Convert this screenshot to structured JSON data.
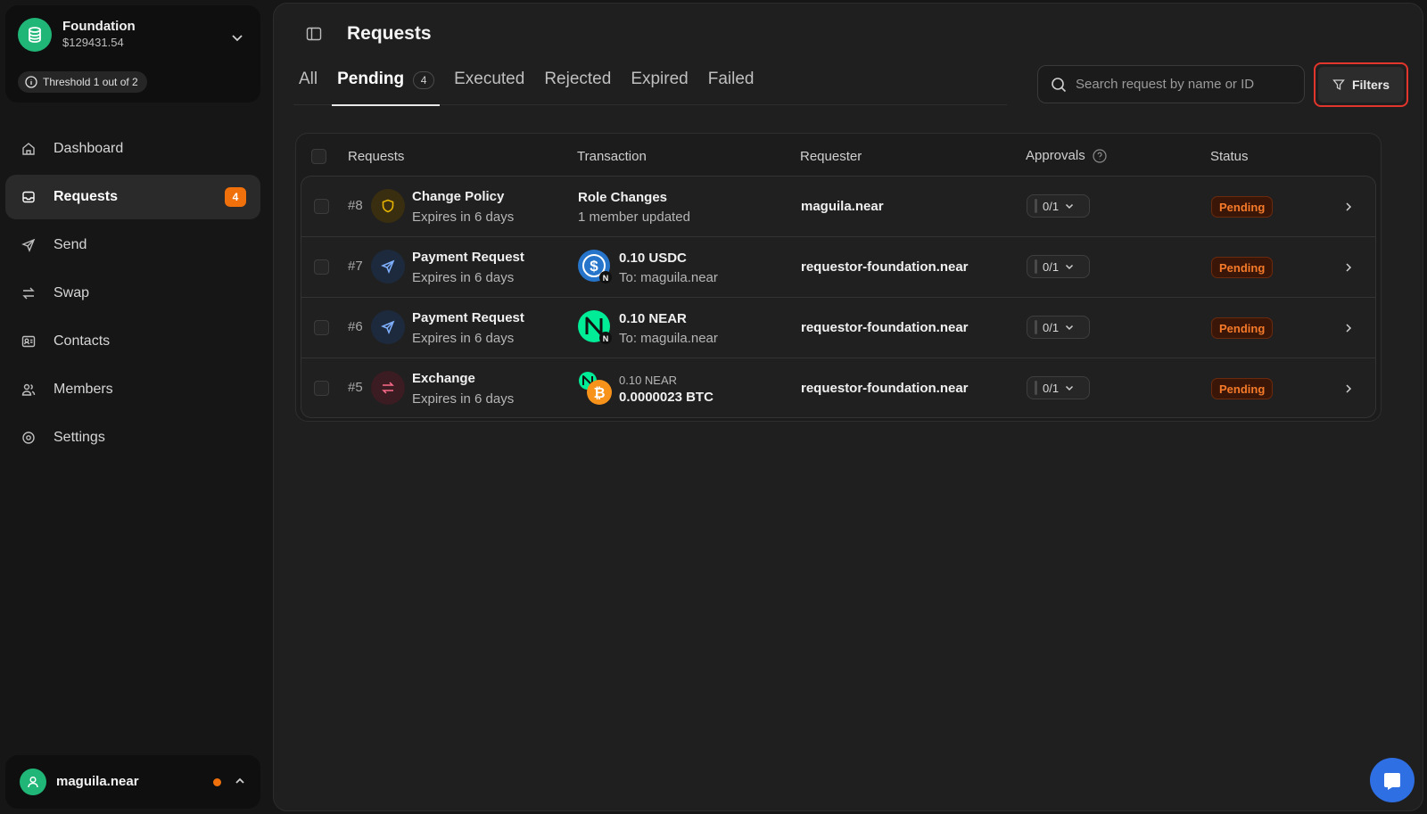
{
  "org": {
    "name": "Foundation",
    "balance": "$129431.54",
    "threshold": "Threshold 1 out of 2"
  },
  "sidebar": {
    "items": [
      {
        "label": "Dashboard",
        "icon": "home-icon"
      },
      {
        "label": "Requests",
        "icon": "inbox-icon",
        "badge": "4",
        "active": true
      },
      {
        "label": "Send",
        "icon": "send-icon"
      },
      {
        "label": "Swap",
        "icon": "swap-icon"
      },
      {
        "label": "Contacts",
        "icon": "contacts-icon"
      },
      {
        "label": "Members",
        "icon": "members-icon"
      },
      {
        "label": "Settings",
        "icon": "gear-icon"
      }
    ]
  },
  "user": {
    "name": "maguila.near"
  },
  "page": {
    "title": "Requests"
  },
  "tabs": [
    {
      "label": "All"
    },
    {
      "label": "Pending",
      "count": "4",
      "active": true
    },
    {
      "label": "Executed"
    },
    {
      "label": "Rejected"
    },
    {
      "label": "Expired"
    },
    {
      "label": "Failed"
    }
  ],
  "search": {
    "placeholder": "Search request by name or ID",
    "value": ""
  },
  "filters": {
    "label": "Filters"
  },
  "table": {
    "headers": {
      "requests": "Requests",
      "transaction": "Transaction",
      "requester": "Requester",
      "approvals": "Approvals",
      "status": "Status"
    },
    "rows": [
      {
        "id": "#8",
        "title": "Change Policy",
        "expires": "Expires in 6 days",
        "icon": "shield-icon",
        "tx_title": "Role Changes",
        "tx_sub": "1 member updated",
        "requester": "maguila.near",
        "approvals": "0/1",
        "status": "Pending"
      },
      {
        "id": "#7",
        "title": "Payment Request",
        "expires": "Expires in 6 days",
        "icon": "send-icon",
        "tx_amount": "0.10 USDC",
        "tx_to": "To: maguila.near",
        "token": "usdc-icon",
        "requester": "requestor-foundation.near",
        "approvals": "0/1",
        "status": "Pending"
      },
      {
        "id": "#6",
        "title": "Payment Request",
        "expires": "Expires in 6 days",
        "icon": "send-icon",
        "tx_amount": "0.10 NEAR",
        "tx_to": "To: maguila.near",
        "token": "near-icon",
        "requester": "requestor-foundation.near",
        "approvals": "0/1",
        "status": "Pending"
      },
      {
        "id": "#5",
        "title": "Exchange",
        "expires": "Expires in 6 days",
        "icon": "swap-icon",
        "tx_from": "0.10 NEAR",
        "tx_to_amount": "0.0000023 BTC",
        "token": "near-btc-icon",
        "requester": "requestor-foundation.near",
        "approvals": "0/1",
        "status": "Pending"
      }
    ]
  },
  "colors": {
    "accent_green": "#1fb677",
    "badge_orange": "#f0700c",
    "status_pending": "#f57a2a",
    "filters_highlight": "#e2352b",
    "chat_blue": "#2f6fe4"
  }
}
